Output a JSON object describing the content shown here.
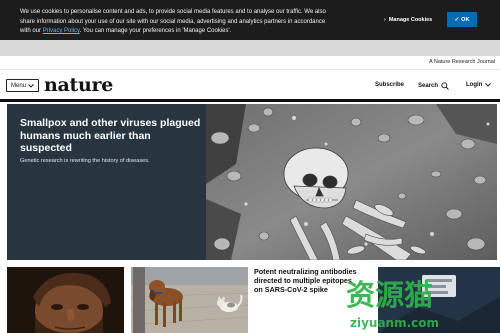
{
  "cookie_banner": {
    "text_before_link": "We use cookies to personalise content and ads, to provide social media features and to analyse our traffic. We also share information about your use of our site with our social media, advertising and analytics partners in accordance with our ",
    "link_text": "Privacy Policy",
    "text_after_link": ". You can manage your preferences in 'Manage Cookies'.",
    "manage_label": "Manage Cookies",
    "ok_label": "OK"
  },
  "header": {
    "journal_label": "A Nature Research Journal",
    "menu_label": "Menu",
    "logo_text": "nature",
    "subscribe_label": "Subscribe",
    "search_label": "Search",
    "login_label": "Login"
  },
  "hero": {
    "title": "Smallpox and other viruses plagued humans much earlier than suspected",
    "subtitle": "Genetic research is rewriting the history of diseases."
  },
  "cards": [
    {
      "title": ""
    },
    {
      "title": ""
    },
    {
      "title": "Potent neutralizing antibodies directed to multiple epitopes on SARS-CoV-2 spike"
    }
  ],
  "watermark": {
    "cn_text": "资源猫",
    "url_text": "ziyuanm.com"
  },
  "colors": {
    "banner_bg": "#1c1c1c",
    "ok_button": "#0a6ab1",
    "hero_bg": "#283440",
    "watermark_green": "#2fb14a"
  }
}
